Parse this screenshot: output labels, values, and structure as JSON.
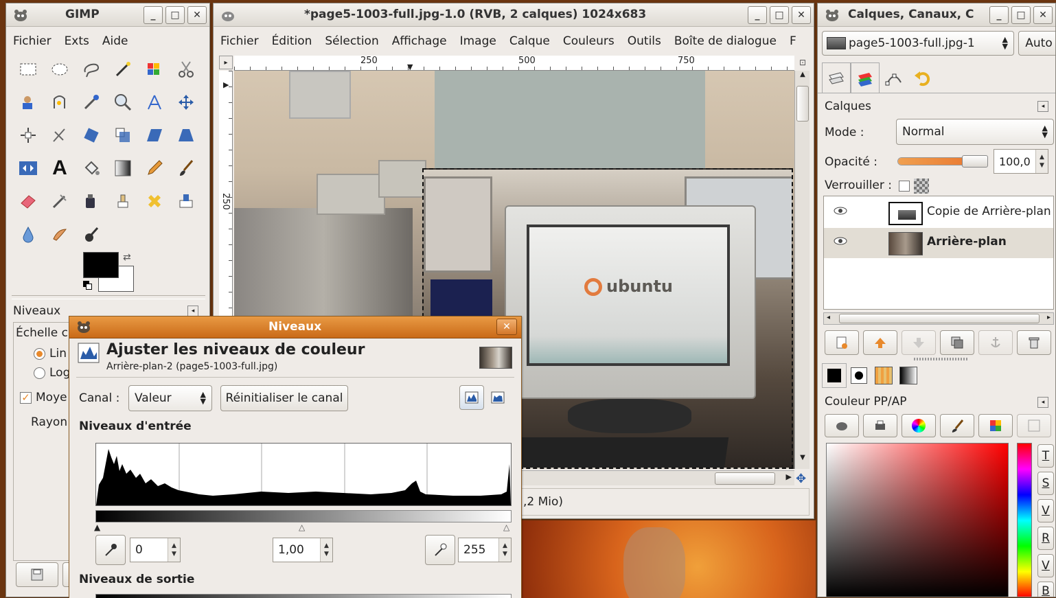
{
  "toolbox": {
    "title": "GIMP",
    "menu": [
      "Fichier",
      "Exts",
      "Aide"
    ],
    "tool_options": {
      "title": "Niveaux",
      "scale_label": "Échelle c",
      "opt_linear": "Lin",
      "opt_log": "Log",
      "average_label": "Moye",
      "radius_label": "Rayon"
    }
  },
  "image_window": {
    "title": "*page5-1003-full.jpg-1.0 (RVB, 2 calques) 1024x683",
    "menu": [
      "Fichier",
      "Édition",
      "Sélection",
      "Affichage",
      "Image",
      "Calque",
      "Couleurs",
      "Outils",
      "Boîte de dialogue",
      "F"
    ],
    "ruler_marks": [
      "250",
      "500",
      "750"
    ],
    "vruler_mark": "250",
    "status": ",2 Mio)",
    "screen_text": "ubuntu"
  },
  "layers_dock": {
    "title": "Calques, Canaux, C",
    "image_select": "page5-1003-full.jpg-1",
    "auto_button": "Auto",
    "panel_title": "Calques",
    "mode_label": "Mode :",
    "mode_value": "Normal",
    "opacity_label": "Opacité :",
    "opacity_value": "100,0",
    "opacity_fraction": 1.0,
    "lock_label": "Verrouiller :",
    "layers": [
      {
        "name": "Copie de Arrière-plan",
        "selected": false
      },
      {
        "name": "Arrière-plan",
        "selected": true
      }
    ],
    "color_panel_title": "Couleur PP/AP",
    "side_buttons": [
      "T",
      "S",
      "V",
      "R",
      "V",
      "B"
    ]
  },
  "levels_dialog": {
    "title": "Niveaux",
    "heading": "Ajuster les niveaux de couleur",
    "subheading": "Arrière-plan-2 (page5-1003-full.jpg)",
    "channel_label": "Canal :",
    "channel_value": "Valeur",
    "reset_button": "Réinitialiser le canal",
    "input_levels_label": "Niveaux d'entrée",
    "input_low": "0",
    "input_gamma": "1,00",
    "input_high": "255",
    "output_levels_label": "Niveaux de sortie"
  },
  "colors": {
    "accent_orange": "#e8892c",
    "selection_row": "#e2ddd4",
    "dialog_title": "#d47a24"
  }
}
